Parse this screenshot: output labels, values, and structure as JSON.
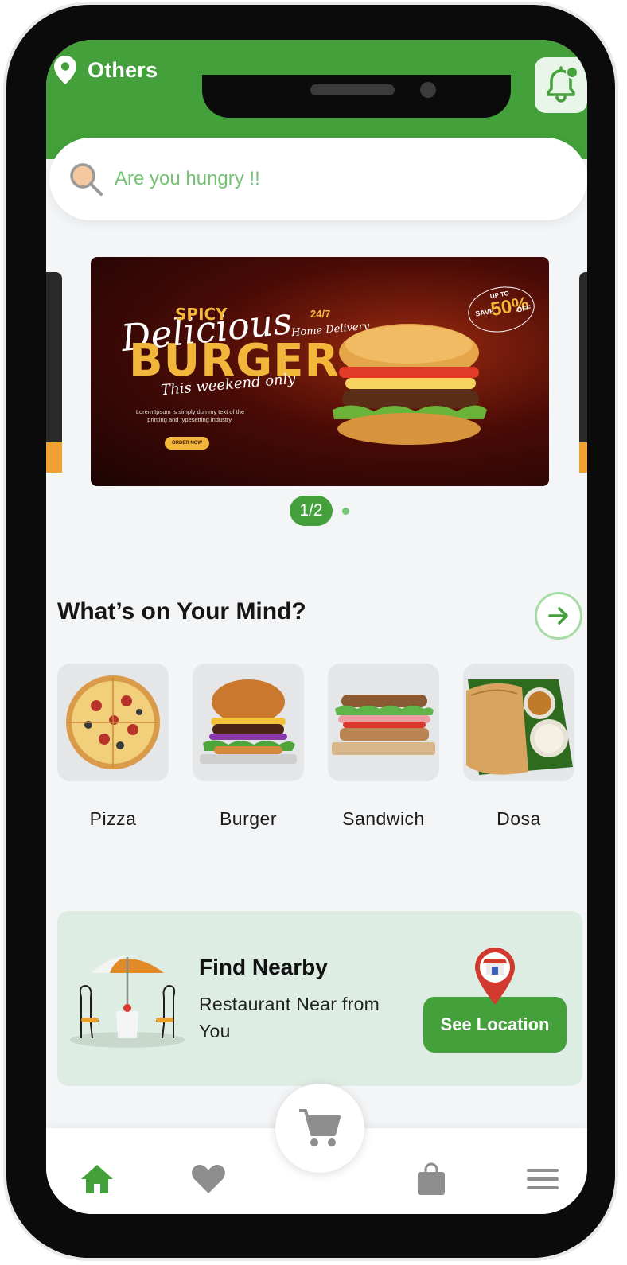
{
  "header": {
    "location_label": "Others",
    "accent_color": "#43a03a"
  },
  "search": {
    "placeholder": "Are you hungry !!"
  },
  "banner": {
    "spicy": "SPICY",
    "delicious": "Delicious",
    "burger": "BURGER",
    "weekend": "This weekend only",
    "lorem": "Lorem Ipsum is simply dummy text of the printing and typesetting industry.",
    "order_now": "ORDER NOW",
    "h247": "24/7",
    "home_delivery": "Home Delivery",
    "up_to": "UP TO",
    "save": "SAVE",
    "discount": "50%",
    "off": "OFF"
  },
  "pager": {
    "label": "1/2",
    "current": 1,
    "total": 2
  },
  "categories_section": {
    "title": "What’s on Your Mind?",
    "items": [
      {
        "label": "Pizza"
      },
      {
        "label": "Burger"
      },
      {
        "label": "Sandwich"
      },
      {
        "label": "Dosa"
      }
    ]
  },
  "nearby": {
    "title": "Find Nearby",
    "subtitle": "Restaurant Near from You",
    "button": "See Location"
  },
  "bottom_nav": {
    "items": [
      {
        "icon": "home-icon",
        "active": true
      },
      {
        "icon": "heart-icon",
        "active": false
      },
      {
        "icon": "cart-icon",
        "active": false
      },
      {
        "icon": "bag-icon",
        "active": false
      },
      {
        "icon": "menu-icon",
        "active": false
      }
    ]
  }
}
